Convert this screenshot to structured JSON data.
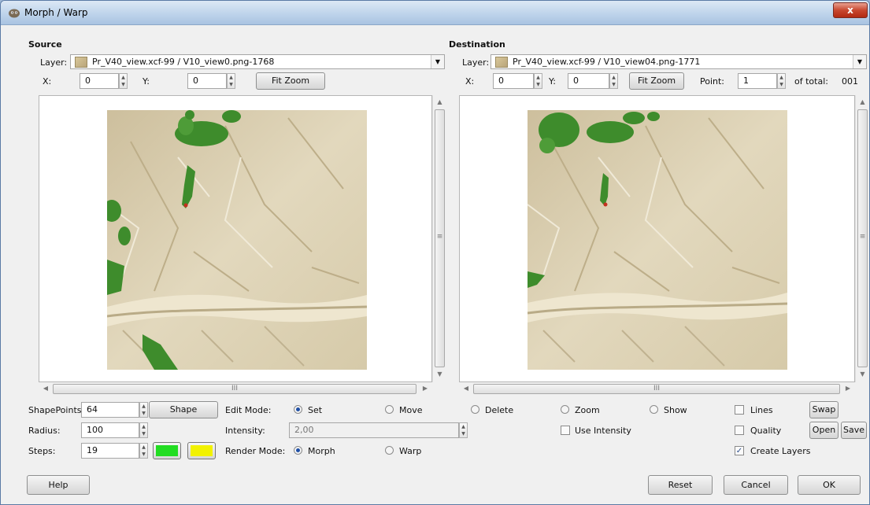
{
  "window": {
    "title": "Morph / Warp",
    "close_glyph": "x"
  },
  "source": {
    "header": "Source",
    "layer_label": "Layer:",
    "layer_value": "Pr_V40_view.xcf-99 / V10_view0.png-1768",
    "x_label": "X:",
    "x_value": "0",
    "y_label": "Y:",
    "y_value": "0",
    "fit_zoom_label": "Fit Zoom",
    "hscroll_grip": "III",
    "vscroll_grip": "≡"
  },
  "destination": {
    "header": "Destination",
    "layer_label": "Layer:",
    "layer_value": "Pr_V40_view.xcf-99 / V10_view04.png-1771",
    "x_label": "X:",
    "x_value": "0",
    "y_label": "Y:",
    "y_value": "0",
    "fit_zoom_label": "Fit Zoom",
    "point_label": "Point:",
    "point_value": "1",
    "of_total_label": "of total:",
    "total_value": "001",
    "hscroll_grip": "III",
    "vscroll_grip": "≡"
  },
  "controls": {
    "shape_points_label": "ShapePoints:",
    "shape_points_value": "64",
    "shape_button": "Shape",
    "radius_label": "Radius:",
    "radius_value": "100",
    "steps_label": "Steps:",
    "steps_value": "19",
    "color1": "#22dd22",
    "color2": "#f2f200",
    "edit_mode_label": "Edit Mode:",
    "edit_set": "Set",
    "edit_move": "Move",
    "edit_delete": "Delete",
    "edit_zoom": "Zoom",
    "edit_show": "Show",
    "edit_mode_selected": "Set",
    "intensity_label": "Intensity:",
    "intensity_value": "2,00",
    "use_intensity": "Use Intensity",
    "use_intensity_checked": false,
    "render_mode_label": "Render Mode:",
    "render_morph": "Morph",
    "render_warp": "Warp",
    "render_mode_selected": "Morph",
    "lines_label": "Lines",
    "lines_checked": false,
    "quality_label": "Quality",
    "quality_checked": false,
    "create_layers_label": "Create Layers",
    "create_layers_checked": true,
    "swap_button": "Swap",
    "open_button": "Open",
    "save_button": "Save"
  },
  "footer": {
    "help": "Help",
    "reset": "Reset",
    "cancel": "Cancel",
    "ok": "OK"
  },
  "colors": {
    "terrain_base": "#ddd2b4",
    "forest_green": "#3e8c2c",
    "accent_blue": "#1f4fa5"
  }
}
